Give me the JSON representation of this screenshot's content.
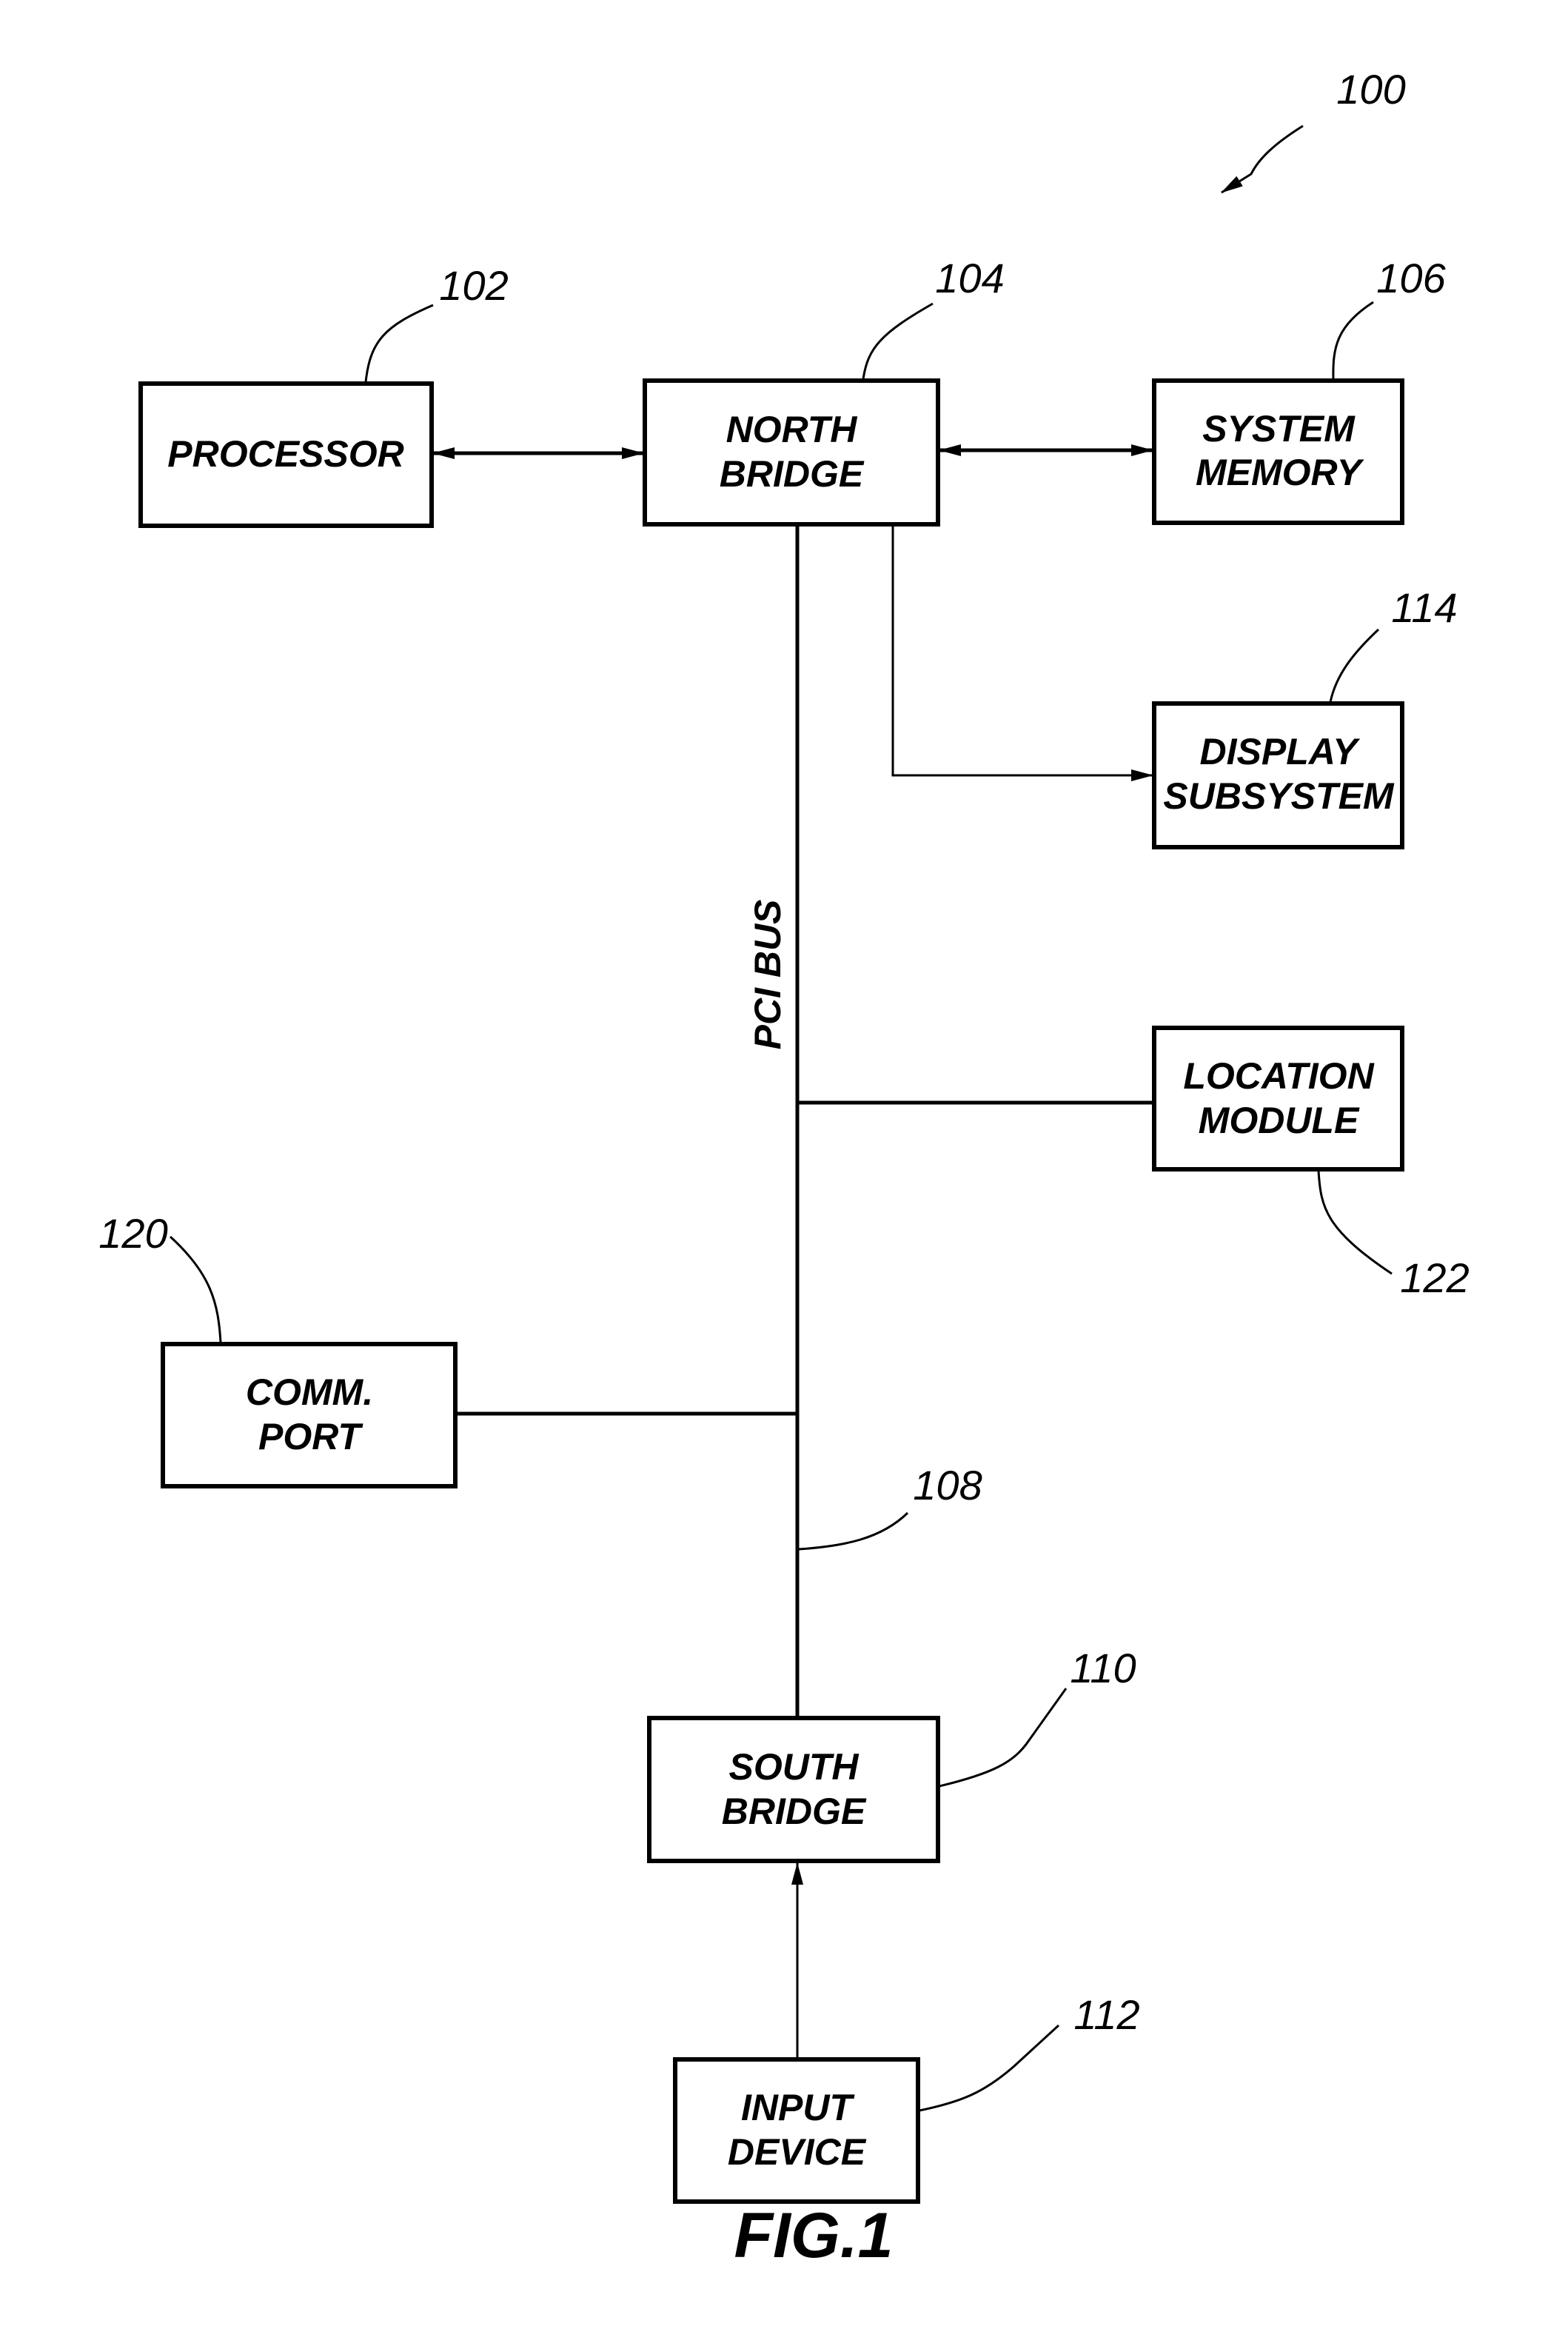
{
  "figure": {
    "caption": "FIG.1",
    "system_ref": "100",
    "bus_label": "PCI BUS",
    "bus_ref": "108"
  },
  "blocks": {
    "processor": {
      "lines": [
        "PROCESSOR"
      ],
      "ref": "102"
    },
    "north_bridge": {
      "lines": [
        "NORTH",
        "BRIDGE"
      ],
      "ref": "104"
    },
    "system_memory": {
      "lines": [
        "SYSTEM",
        "MEMORY"
      ],
      "ref": "106"
    },
    "display_subsystem": {
      "lines": [
        "DISPLAY",
        "SUBSYSTEM"
      ],
      "ref": "114"
    },
    "location_module": {
      "lines": [
        "LOCATION",
        "MODULE"
      ],
      "ref": "122"
    },
    "comm_port": {
      "lines": [
        "COMM.",
        "PORT"
      ],
      "ref": "120"
    },
    "south_bridge": {
      "lines": [
        "SOUTH",
        "BRIDGE"
      ],
      "ref": "110"
    },
    "input_device": {
      "lines": [
        "INPUT",
        "DEVICE"
      ],
      "ref": "112"
    }
  },
  "connections": [
    {
      "from": "processor",
      "to": "north_bridge",
      "type": "bidirectional"
    },
    {
      "from": "north_bridge",
      "to": "system_memory",
      "type": "bidirectional"
    },
    {
      "from": "north_bridge",
      "to": "display_subsystem",
      "type": "directed"
    },
    {
      "from": "north_bridge",
      "to": "south_bridge",
      "type": "bus",
      "label": "PCI BUS"
    },
    {
      "from": "pci_bus",
      "to": "location_module",
      "type": "line"
    },
    {
      "from": "pci_bus",
      "to": "comm_port",
      "type": "line"
    },
    {
      "from": "input_device",
      "to": "south_bridge",
      "type": "directed"
    }
  ]
}
